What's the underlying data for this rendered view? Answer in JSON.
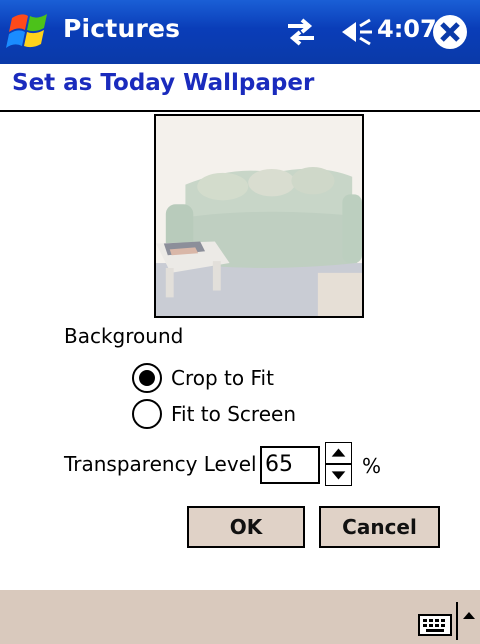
{
  "app": {
    "title": "Pictures",
    "clock": "4:07"
  },
  "page": {
    "title": "Set as Today Wallpaper"
  },
  "preview": {
    "alt": "Wallpaper preview: living room with sofa"
  },
  "background": {
    "label": "Background",
    "options": [
      {
        "label": "Crop to Fit",
        "selected": true
      },
      {
        "label": "Fit to Screen",
        "selected": false
      }
    ]
  },
  "transparency": {
    "label": "Transparency Level",
    "value": "65",
    "unit": "%"
  },
  "buttons": {
    "ok": "OK",
    "cancel": "Cancel"
  },
  "colors": {
    "titlebar": "#0a3db8",
    "page_title": "#1a2bbd",
    "button_face": "#e0d2c7",
    "menubar": "#d9c9bd"
  },
  "icons": {
    "start": "windows-flag-icon",
    "connectivity": "connectivity-arrows-icon",
    "volume": "speaker-icon",
    "close": "close-icon",
    "keyboard": "keyboard-icon",
    "sip": "sip-up-arrow-icon"
  }
}
